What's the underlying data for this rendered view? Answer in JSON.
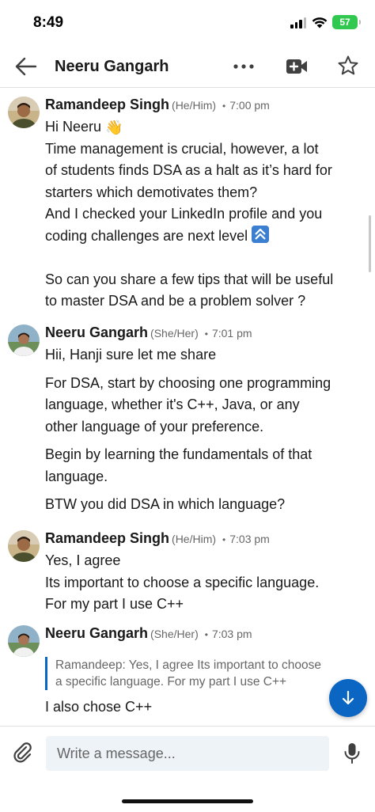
{
  "status_bar": {
    "time": "8:49",
    "battery": "57"
  },
  "header": {
    "title": "Neeru Gangarh"
  },
  "messages": [
    {
      "sender": "Ramandeep Singh",
      "pronoun": "(He/Him)",
      "time": "7:00 pm",
      "lines": {
        "l1": "Hi Neeru",
        "l1_emoji": "👋",
        "l2": "Time management is crucial, however, a lot",
        "l3": "of students finds DSA as a halt as it’s hard for",
        "l4": "starters which demotivates them?",
        "l5": "And I checked your LinkedIn profile and you",
        "l6": "coding challenges are next level",
        "l8": "So can you share a few tips that will be useful",
        "l9": "to master DSA and be a problem solver ?"
      }
    },
    {
      "sender": "Neeru Gangarh",
      "pronoun": "(She/Her)",
      "time": "7:01 pm",
      "lines": {
        "l1": "Hii, Hanji sure let me share",
        "l2": "For DSA, start by choosing one programming",
        "l3": "language, whether it's C++, Java, or any",
        "l4": "other language of your preference.",
        "l5": "Begin by learning the fundamentals of that",
        "l6": "language.",
        "l7": "BTW you did DSA in which language?"
      }
    },
    {
      "sender": "Ramandeep Singh",
      "pronoun": "(He/Him)",
      "time": "7:03 pm",
      "lines": {
        "l1": "Yes, I agree",
        "l2": "Its important to choose a specific language.",
        "l3": "For my part I use C++"
      }
    },
    {
      "sender": "Neeru Gangarh",
      "pronoun": "(She/Her)",
      "time": "7:03 pm",
      "quote": {
        "l1": "Ramandeep: Yes, I agree Its important to choose",
        "l2": "a specific language. For my part I use C++"
      },
      "lines": {
        "l1": "I also chose C++"
      }
    }
  ],
  "composer": {
    "placeholder": "Write a message..."
  },
  "colors": {
    "accent": "#0a66c2",
    "battery": "#30c84e",
    "input_bg": "#eef3f8"
  },
  "icons": {
    "back": "arrow-left-icon",
    "more": "more-icon",
    "video": "video-call-icon",
    "star": "star-icon",
    "attach": "paperclip-icon",
    "mic": "microphone-icon",
    "scroll": "arrow-down-icon",
    "up": "up-arrows-emoji-icon"
  }
}
